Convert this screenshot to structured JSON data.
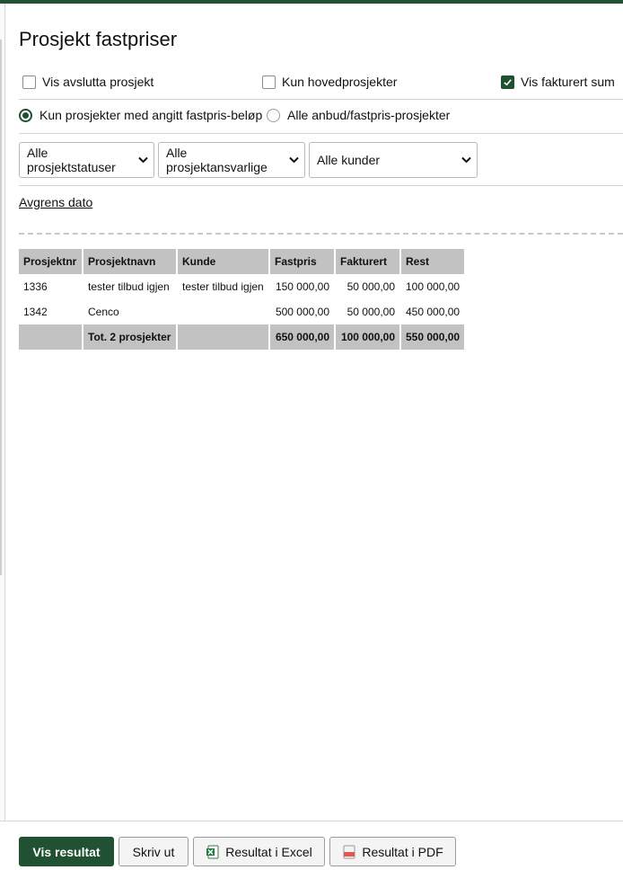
{
  "page": {
    "title": "Prosjekt fastpriser"
  },
  "options": {
    "show_closed": {
      "label": "Vis avslutta prosjekt",
      "checked": false
    },
    "main_only": {
      "label": "Kun hovedprosjekter",
      "checked": false
    },
    "show_invoiced_sum": {
      "label": "Vis fakturert sum",
      "checked": true
    }
  },
  "radios": {
    "fixed_amount": {
      "label": "Kun prosjekter med angitt fastpris-beløp",
      "selected": true
    },
    "all_bids": {
      "label": "Alle anbud/fastpris-prosjekter",
      "selected": false
    }
  },
  "filters": {
    "status": "Alle prosjektstatuser",
    "responsible": "Alle prosjektansvarlige",
    "customer": "Alle kunder"
  },
  "date_limit_link": "Avgrens dato",
  "table": {
    "headers": [
      "Prosjektnr",
      "Prosjektnavn",
      "Kunde",
      "Fastpris",
      "Fakturert",
      "Rest"
    ],
    "rows": [
      [
        "1336",
        "tester tilbud igjen",
        "tester tilbud igjen",
        "150 000,00",
        "50 000,00",
        "100 000,00"
      ],
      [
        "1342",
        "Cenco",
        "",
        "500 000,00",
        "50 000,00",
        "450 000,00"
      ]
    ],
    "total": [
      "",
      "Tot. 2 prosjekter",
      "",
      "650 000,00",
      "100 000,00",
      "550 000,00"
    ]
  },
  "buttons": {
    "show_result": "Vis resultat",
    "print": "Skriv ut",
    "excel": "Resultat i Excel",
    "pdf": "Resultat i PDF"
  },
  "colors": {
    "accent": "#1f5132",
    "header_bg": "#c2c2c2"
  }
}
